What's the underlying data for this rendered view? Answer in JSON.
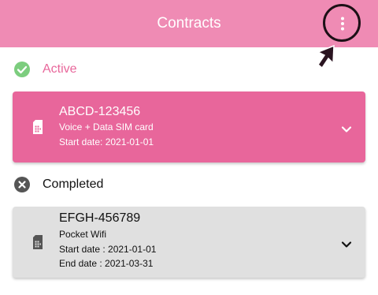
{
  "header": {
    "title": "Contracts"
  },
  "icons": {
    "menu": "more-vert-icon",
    "cursor": "cursor-arrow-icon",
    "active": "check-circle-icon",
    "completed": "cancel-circle-icon",
    "sim": "sim-card-icon",
    "expand": "chevron-down-icon"
  },
  "colors": {
    "appbar": "#ef8bb4",
    "active_accent": "#e8679b",
    "active_card": "#e8669b",
    "completed_card": "#e0e0e0",
    "check_green": "#7ccd7e"
  },
  "sections": {
    "active": {
      "label": "Active",
      "contracts": [
        {
          "id": "ABCD-123456",
          "plan": "Voice + Data SIM card",
          "start": "Start date: 2021-01-01"
        }
      ]
    },
    "completed": {
      "label": "Completed",
      "contracts": [
        {
          "id": "EFGH-456789",
          "plan": "Pocket Wifi",
          "start": "Start date : 2021-01-01",
          "end": "End date : 2021-03-31"
        }
      ]
    }
  }
}
